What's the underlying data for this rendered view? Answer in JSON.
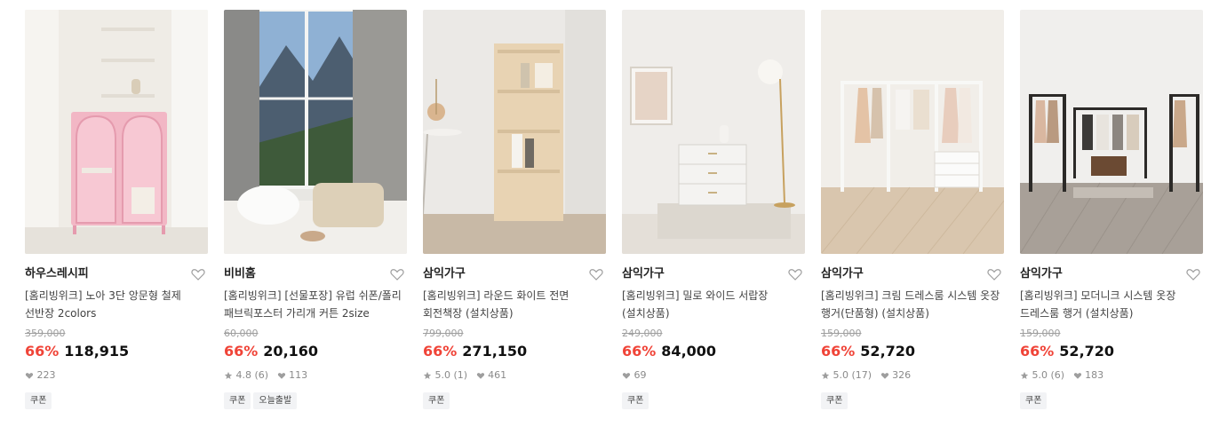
{
  "products": [
    {
      "brand": "하우스레시피",
      "title": "[홈리빙위크] 노아 3단 앙문형 철제 선반장 2colors",
      "original_price": "359,000",
      "discount": "66%",
      "price": "118,915",
      "rating": "",
      "reviews": "",
      "likes": "223",
      "tags": [
        "쿠폰"
      ]
    },
    {
      "brand": "비비홈",
      "title": "[홈리빙위크] [선물포장] 유럽 쉬폰/폴리 패브릭포스터 가리개 커튼 2size",
      "original_price": "60,000",
      "discount": "66%",
      "price": "20,160",
      "rating": "4.8",
      "reviews": "(6)",
      "likes": "113",
      "tags": [
        "쿠폰",
        "오늘출발"
      ]
    },
    {
      "brand": "삼익가구",
      "title": "[홈리빙위크] 라운드 화이트 전면 회전책장 (설치상품)",
      "original_price": "799,000",
      "discount": "66%",
      "price": "271,150",
      "rating": "5.0",
      "reviews": "(1)",
      "likes": "461",
      "tags": [
        "쿠폰"
      ]
    },
    {
      "brand": "삼익가구",
      "title": "[홈리빙위크] 밀로 와이드 서랍장 (설치상품)",
      "original_price": "249,000",
      "discount": "66%",
      "price": "84,000",
      "rating": "",
      "reviews": "",
      "likes": "69",
      "tags": [
        "쿠폰"
      ]
    },
    {
      "brand": "삼익가구",
      "title": "[홈리빙위크] 크림 드레스룸 시스템 옷장 행거(단품형) (설치상품)",
      "original_price": "159,000",
      "discount": "66%",
      "price": "52,720",
      "rating": "5.0",
      "reviews": "(17)",
      "likes": "326",
      "tags": [
        "쿠폰"
      ]
    },
    {
      "brand": "삼익가구",
      "title": "[홈리빙위크] 모더니크 시스템 옷장 드레스룸 행거 (설치상품)",
      "original_price": "159,000",
      "discount": "66%",
      "price": "52,720",
      "rating": "5.0",
      "reviews": "(6)",
      "likes": "183",
      "tags": [
        "쿠폰"
      ]
    }
  ],
  "colors": {
    "discount": "#f04438",
    "tag_bg": "#f2f3f5"
  }
}
